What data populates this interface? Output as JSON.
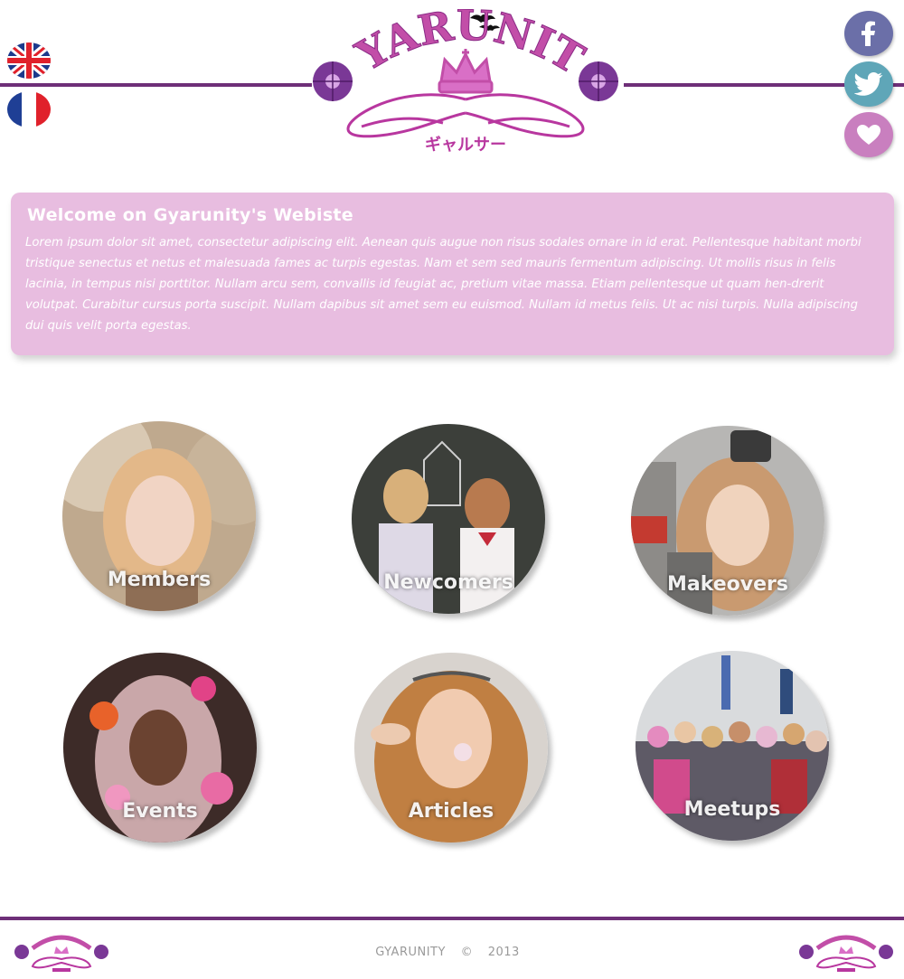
{
  "header": {
    "logo_text": "GYARUNITY",
    "logo_subtitle": "ギャルサー",
    "languages": [
      {
        "icon": "uk-flag-icon"
      },
      {
        "icon": "france-flag-icon"
      }
    ],
    "social": [
      {
        "icon": "facebook-icon",
        "color": "#6b6fa8"
      },
      {
        "icon": "twitter-icon",
        "color": "#5fa6b8"
      },
      {
        "icon": "heart-icon",
        "color": "#c97fbf"
      }
    ],
    "line_color": "#6e2f78"
  },
  "welcome": {
    "title": "Welcome on Gyarunity's Webiste",
    "body": "Lorem ipsum dolor sit amet, consectetur adipiscing elit. Aenean quis augue non risus sodales ornare in id erat. Pellentesque habitant morbi tristique senectus et netus et malesuada fames ac turpis egestas. Nam et sem sed mauris fermentum adipiscing. Ut mollis risus in felis lacinia, in tempus nisi porttitor. Nullam arcu sem, convallis id feugiat ac, pretium vitae massa. Etiam pellentesque ut quam hen-drerit volutpat. Curabitur cursus porta suscipit. Nullam dapibus sit amet sem eu euismod. Nullam id metus felis. Ut ac nisi turpis. Nulla adipiscing dui quis velit porta egestas.",
    "background": "#e8bde0"
  },
  "sections": [
    {
      "label": "Members"
    },
    {
      "label": "Newcomers"
    },
    {
      "label": "Makeovers"
    },
    {
      "label": "Events"
    },
    {
      "label": "Articles"
    },
    {
      "label": "Meetups"
    }
  ],
  "footer": {
    "brand": "GYARUNITY",
    "symbol": "©",
    "year": "2013"
  }
}
